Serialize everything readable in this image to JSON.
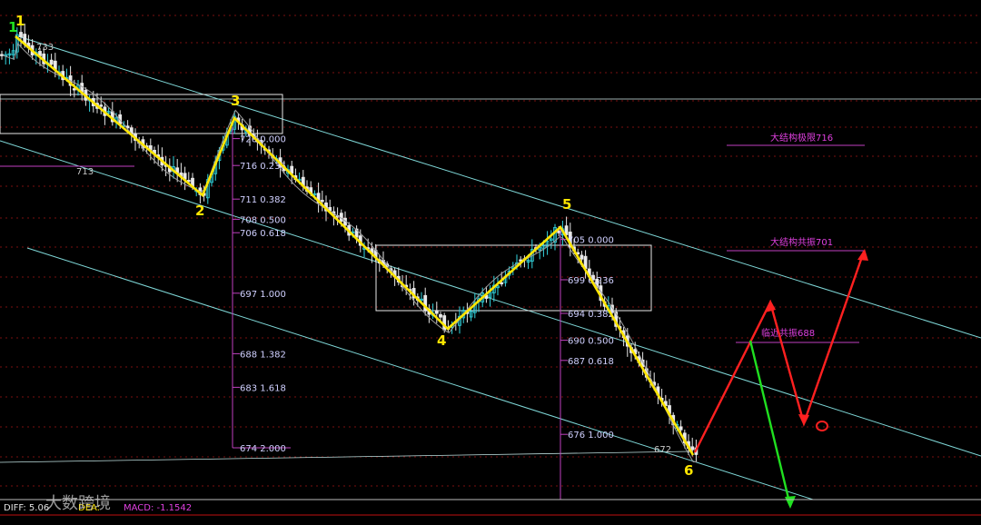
{
  "colors": {
    "background": "#000000",
    "grid": "#7a1010",
    "channel": "#7fd8d8",
    "candle_up": "#33d6e0",
    "candle_down": "#e8e8e8",
    "ma": "#9c9c9c",
    "wave": "#ffe600",
    "fib": "#c040c0",
    "forecast_up": "#ff2020",
    "forecast_down": "#20e020",
    "box": "#e8e8e8"
  },
  "chart_data": {
    "type": "candlestick",
    "wave_points": [
      {
        "label": "1",
        "price": 733
      },
      {
        "label": "2",
        "price": 711
      },
      {
        "label": "3",
        "price": 720
      },
      {
        "label": "4",
        "price": 694
      },
      {
        "label": "5",
        "price": 705
      },
      {
        "label": "6",
        "price": 672
      }
    ],
    "wave_start_label": "1",
    "price_tags": [
      "733",
      "713",
      "672"
    ],
    "fib_set_1": [
      {
        "price": "720",
        "ratio": "0.000"
      },
      {
        "price": "716",
        "ratio": "0.236"
      },
      {
        "price": "711",
        "ratio": "0.382"
      },
      {
        "price": "708",
        "ratio": "0.500"
      },
      {
        "price": "706",
        "ratio": "0.618"
      },
      {
        "price": "697",
        "ratio": "1.000"
      },
      {
        "price": "688",
        "ratio": "1.382"
      },
      {
        "price": "683",
        "ratio": "1.618"
      },
      {
        "price": "674",
        "ratio": "2.000"
      }
    ],
    "fib_set_2": [
      {
        "price": "705",
        "ratio": "0.000"
      },
      {
        "price": "699",
        "ratio": "0.236"
      },
      {
        "price": "694",
        "ratio": "0.382"
      },
      {
        "price": "690",
        "ratio": "0.500"
      },
      {
        "price": "687",
        "ratio": "0.618"
      },
      {
        "price": "676",
        "ratio": "1.000"
      }
    ],
    "annotations": [
      "大结构极限716",
      "大结构共振701",
      "临近共振688"
    ],
    "macd": {
      "diff_label": "DIFF: 5.06",
      "dea_label": "DEA:",
      "macd_label": "MACD: -1.1542"
    },
    "watermark": "大数跨境",
    "grid": true
  }
}
